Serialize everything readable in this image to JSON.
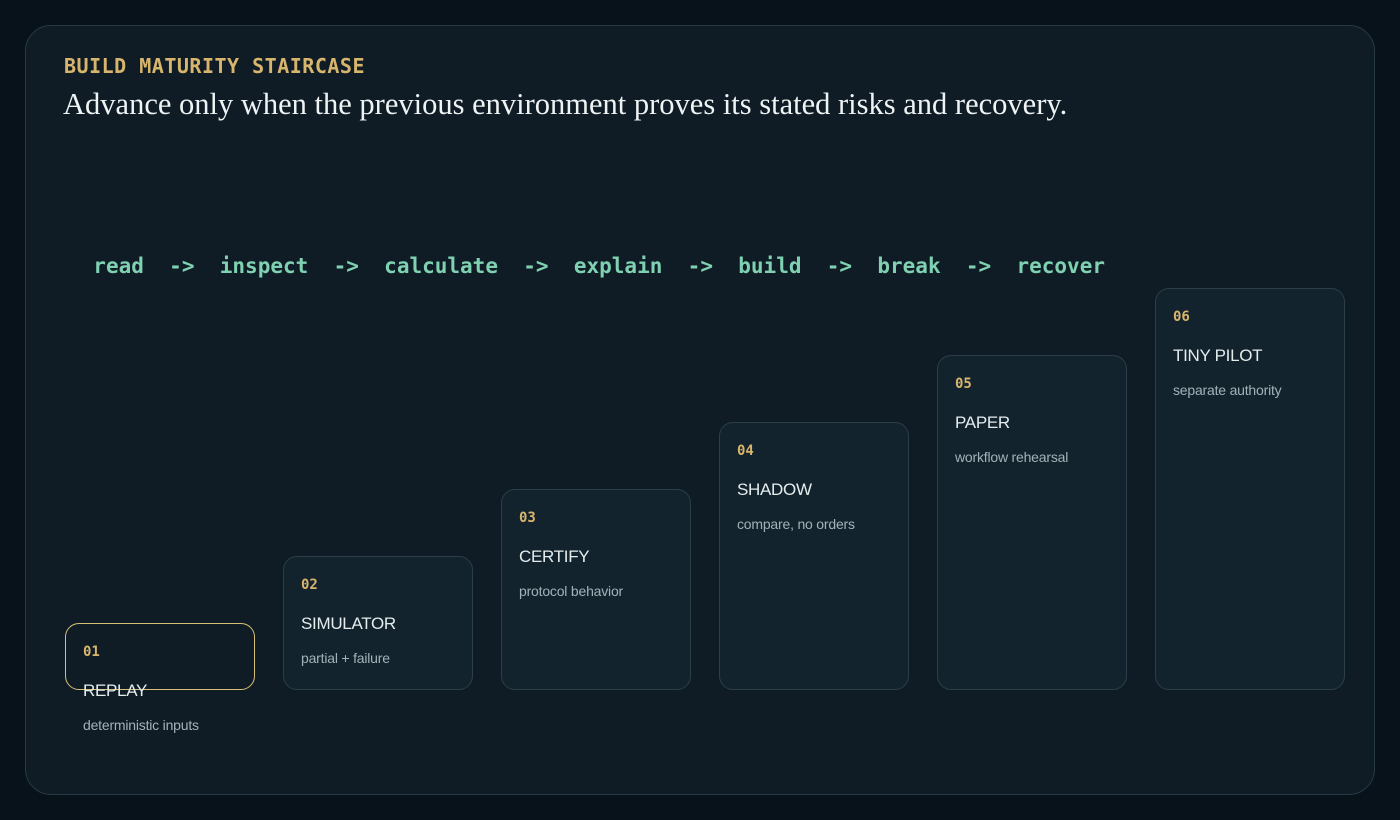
{
  "header": {
    "eyebrow": "BUILD MATURITY STAIRCASE",
    "headline": "Advance only when the previous environment proves its stated risks and recovery."
  },
  "flow": {
    "separator": "->",
    "steps": [
      "read",
      "inspect",
      "calculate",
      "explain",
      "build",
      "break",
      "recover"
    ]
  },
  "staircase": {
    "active_index": 0,
    "steps": [
      {
        "number": "01",
        "name": "REPLAY",
        "description": "deterministic inputs",
        "level": 1
      },
      {
        "number": "02",
        "name": "SIMULATOR",
        "description": "partial + failure",
        "level": 2
      },
      {
        "number": "03",
        "name": "CERTIFY",
        "description": "protocol behavior",
        "level": 3
      },
      {
        "number": "04",
        "name": "SHADOW",
        "description": "compare, no orders",
        "level": 4
      },
      {
        "number": "05",
        "name": "PAPER",
        "description": "workflow rehearsal",
        "level": 5
      },
      {
        "number": "06",
        "name": "TINY PILOT",
        "description": "separate authority",
        "level": 6
      }
    ]
  }
}
